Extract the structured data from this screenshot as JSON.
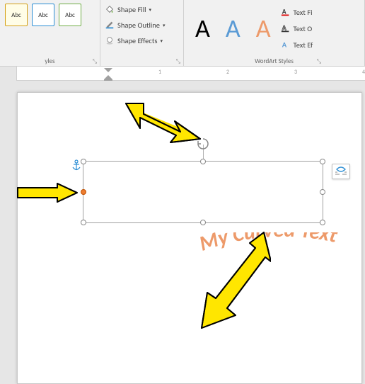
{
  "ribbon": {
    "styles": {
      "label": "yles",
      "gallery": [
        "Abc",
        "Abc",
        "Abc"
      ]
    },
    "shape": {
      "fill": "Shape Fill",
      "outline": "Shape Outline",
      "effects": "Shape Effects"
    },
    "wordart": {
      "label": "WordArt Styles",
      "gallery": [
        "A",
        "A",
        "A"
      ],
      "text_fill": "Text Fi",
      "text_outline": "Text O",
      "text_effects": "Text Ef"
    }
  },
  "ruler": {
    "numbers": [
      "1",
      "2",
      "3",
      "4"
    ]
  },
  "textbox": {
    "content": "My Curved Text"
  },
  "chart_data": {
    "type": "annotated-screenshot",
    "annotations": [
      {
        "name": "rotation-handle-arrow",
        "dir": "down-right"
      },
      {
        "name": "adjust-handle-arrow",
        "dir": "right"
      },
      {
        "name": "bottom-mid-handle-arrow",
        "dir": "up-left"
      }
    ]
  }
}
